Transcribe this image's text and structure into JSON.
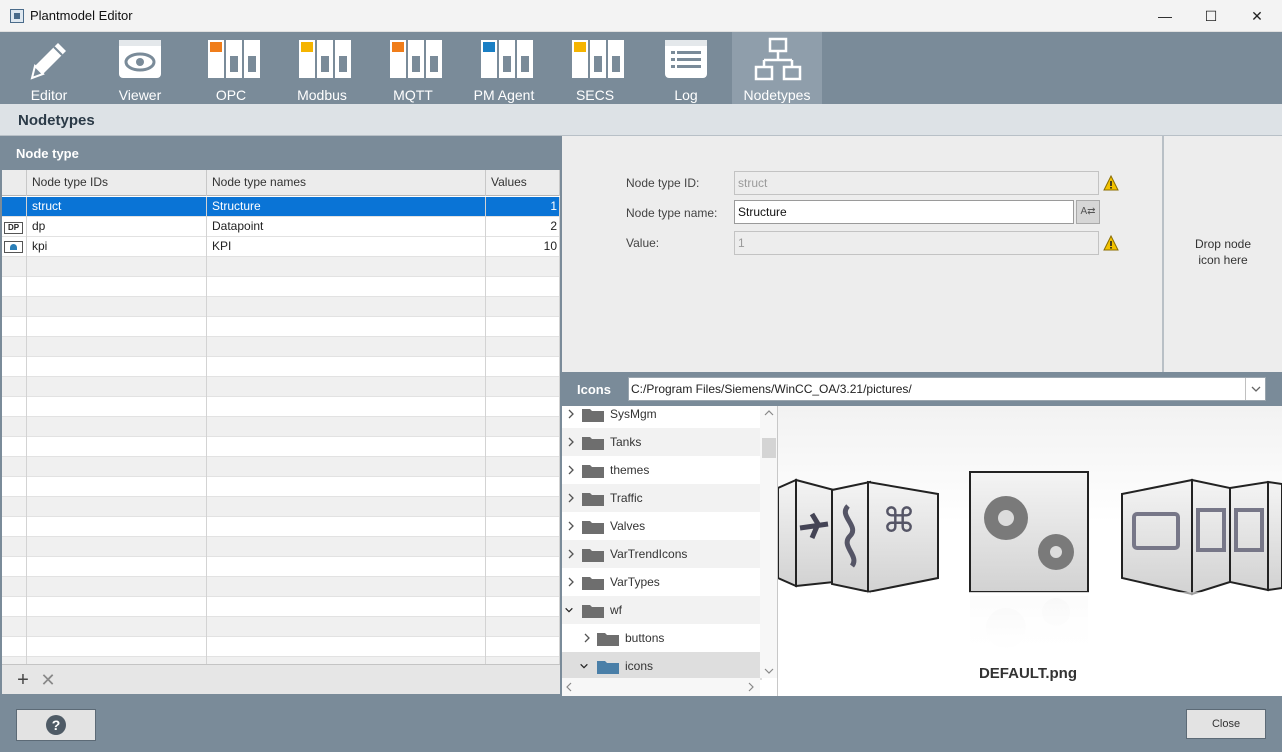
{
  "window": {
    "title": "Plantmodel Editor"
  },
  "toolbar": {
    "items": [
      {
        "label": "Editor",
        "icon": "pencil-icon"
      },
      {
        "label": "Viewer",
        "icon": "eye-icon"
      },
      {
        "label": "OPC",
        "icon": "opc-device-icon"
      },
      {
        "label": "Modbus",
        "icon": "modbus-device-icon"
      },
      {
        "label": "MQTT",
        "icon": "mqtt-device-icon"
      },
      {
        "label": "PM Agent",
        "icon": "pm-agent-device-icon"
      },
      {
        "label": "SECS",
        "icon": "secs-device-icon"
      },
      {
        "label": "Log",
        "icon": "log-list-icon"
      },
      {
        "label": "Nodetypes",
        "icon": "network-tree-icon",
        "active": true
      }
    ]
  },
  "page": {
    "title": "Nodetypes"
  },
  "nodetype_panel": {
    "title": "Node type",
    "columns": [
      "Node type IDs",
      "Node type names",
      "Values"
    ],
    "rows": [
      {
        "icon": "",
        "id": "struct",
        "name": "Structure",
        "value": "1"
      },
      {
        "icon": "DP",
        "id": "dp",
        "name": "Datapoint",
        "value": "2"
      },
      {
        "icon": "kpi-gauge-icon",
        "id": "kpi",
        "name": "KPI",
        "value": "10"
      }
    ]
  },
  "form": {
    "id_label": "Node type ID:",
    "id_value": "struct",
    "name_label": "Node type name:",
    "name_value": "Structure",
    "value_label": "Value:",
    "value_value": "1",
    "translate_icon": "translate-icon",
    "warning_color": "#f2c200"
  },
  "dropzone": {
    "line1": "Drop node",
    "line2": "icon here"
  },
  "icons_panel": {
    "title": "Icons",
    "path": "C:/Program Files/Siemens/WinCC_OA/3.21/pictures/",
    "tree": [
      {
        "label": "SysMgm",
        "level": 0,
        "expanded": false
      },
      {
        "label": "Tanks",
        "level": 0,
        "expanded": false
      },
      {
        "label": "themes",
        "level": 0,
        "expanded": false
      },
      {
        "label": "Traffic",
        "level": 0,
        "expanded": false
      },
      {
        "label": "Valves",
        "level": 0,
        "expanded": false
      },
      {
        "label": "VarTrendIcons",
        "level": 0,
        "expanded": false
      },
      {
        "label": "VarTypes",
        "level": 0,
        "expanded": false
      },
      {
        "label": "wf",
        "level": 0,
        "expanded": true
      },
      {
        "label": "buttons",
        "level": 1,
        "expanded": false
      },
      {
        "label": "icons",
        "level": 1,
        "expanded": true,
        "selected": true
      }
    ],
    "selected_file": "DEFAULT.png"
  },
  "footer": {
    "help_label": "?",
    "close_label": "Close"
  },
  "colors": {
    "toolbar": "#7a8b99",
    "selection": "#0a74d6",
    "accent_orange": "#f07d1a",
    "accent_yellow": "#f5b400",
    "accent_blue": "#1a7fc4"
  }
}
